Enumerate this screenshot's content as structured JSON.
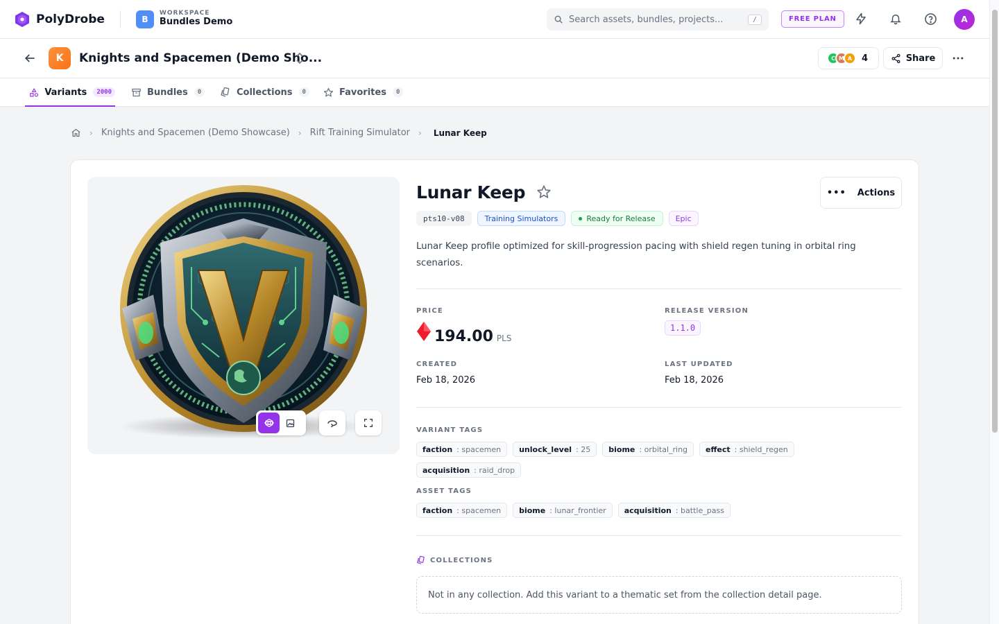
{
  "app": {
    "name": "PolyDrobe"
  },
  "workspace": {
    "kicker": "WORKSPACE",
    "name": "Bundles Demo",
    "badge": "B"
  },
  "search": {
    "placeholder": "Search assets, bundles, projects...",
    "shortcut": "/"
  },
  "plan": {
    "label": "FREE PLAN"
  },
  "user": {
    "avatar": "A"
  },
  "project": {
    "badge": "K",
    "title": "Knights and Spacemen (Demo Sho...",
    "collaborators": [
      "C",
      "M",
      "A"
    ],
    "collaborator_count": "4",
    "share_label": "Share"
  },
  "tabs": [
    {
      "label": "Variants",
      "count": "2000"
    },
    {
      "label": "Bundles",
      "count": "0"
    },
    {
      "label": "Collections",
      "count": "0"
    },
    {
      "label": "Favorites",
      "count": "0"
    }
  ],
  "breadcrumb": [
    "Knights and Spacemen (Demo Showcase)",
    "Rift Training Simulator",
    "Lunar Keep"
  ],
  "variant": {
    "title": "Lunar Keep",
    "actions_label": "Actions",
    "code": "pts10-v08",
    "category": "Training Simulators",
    "status": "Ready for Release",
    "rarity": "Epic",
    "description": "Lunar Keep profile optimized for skill-progression pacing with shield regen tuning in orbital ring scenarios.",
    "price_label": "PRICE",
    "price": "194.00",
    "currency": "PLS",
    "release_label": "RELEASE VERSION",
    "release_version": "1.1.0",
    "created_label": "CREATED",
    "created": "Feb 18, 2026",
    "updated_label": "LAST UPDATED",
    "updated": "Feb 18, 2026",
    "variant_tags_label": "VARIANT TAGS",
    "variant_tags": [
      {
        "key": "faction",
        "value": ": spacemen"
      },
      {
        "key": "unlock_level",
        "value": ": 25"
      },
      {
        "key": "biome",
        "value": ": orbital_ring"
      },
      {
        "key": "effect",
        "value": ": shield_regen"
      },
      {
        "key": "acquisition",
        "value": ": raid_drop"
      }
    ],
    "asset_tags_label": "ASSET TAGS",
    "asset_tags": [
      {
        "key": "faction",
        "value": ": spacemen"
      },
      {
        "key": "biome",
        "value": ": lunar_frontier"
      },
      {
        "key": "acquisition",
        "value": ": battle_pass"
      }
    ],
    "collections_label": "COLLECTIONS",
    "collections_empty": "Not in any collection. Add this variant to a thematic set from the collection detail page."
  },
  "colors": {
    "accent": "#9333ea",
    "price_gem": "#ef1c2b",
    "project_badge": "#f97316",
    "workspace_badge": "#4f8ff7"
  }
}
